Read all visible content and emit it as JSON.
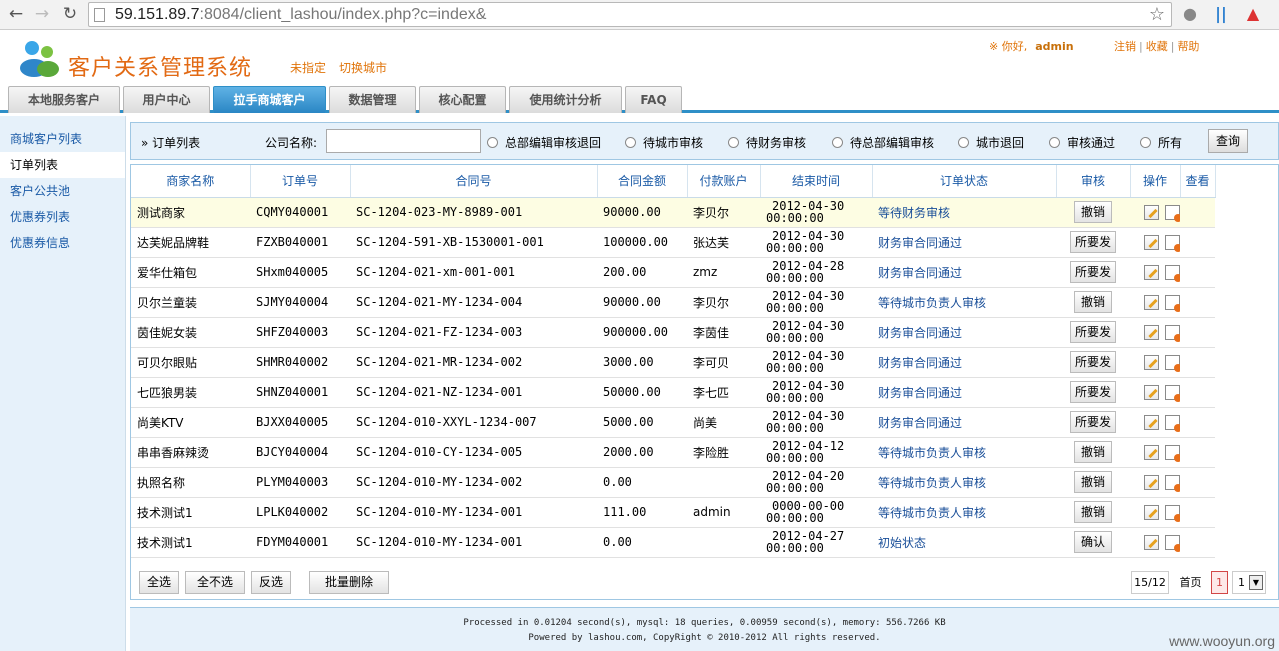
{
  "browser": {
    "url_host": "59.151.89.7",
    "url_rest": ":8084/client_lashou/index.php?c=index&"
  },
  "header": {
    "title": "客户关系管理系统",
    "unspecified": "未指定",
    "switch_city": "切换城市",
    "greeting": "※ 你好,",
    "username": "admin",
    "links": [
      "注销",
      "收藏",
      "帮助"
    ]
  },
  "tabs": [
    {
      "label": "本地服务客户"
    },
    {
      "label": "用户中心"
    },
    {
      "label": "拉手商城客户",
      "active": true
    },
    {
      "label": "数据管理"
    },
    {
      "label": "核心配置"
    },
    {
      "label": "使用统计分析"
    },
    {
      "label": "FAQ"
    }
  ],
  "sidebar": {
    "items": [
      {
        "label": "商城客户列表"
      },
      {
        "label": "订单列表",
        "active": true
      },
      {
        "label": "客户公共池"
      },
      {
        "label": "优惠券列表"
      },
      {
        "label": "优惠券信息"
      }
    ]
  },
  "filter": {
    "crumb": "» 订单列表",
    "company_label": "公司名称:",
    "company_value": "",
    "radios": [
      "总部编辑审核退回",
      "待城市审核",
      "待财务审核",
      "待总部编辑审核",
      "城市退回",
      "审核通过",
      "所有"
    ],
    "query_label": "查询"
  },
  "table": {
    "headers": [
      "商家名称",
      "订单号",
      "合同号",
      "合同金额",
      "付款账户",
      "结束时间",
      "订单状态",
      "审核",
      "操作",
      "查看"
    ],
    "rows": [
      {
        "merchant": "测试商家",
        "order": "CQMY040001",
        "contract": "SC-1204-023-MY-8989-001",
        "amount": "90000.00",
        "account": "李贝尔",
        "end_date": "2012-04-30",
        "end_time": "00:00:00",
        "status": "等待财务审核",
        "audit": "撤销"
      },
      {
        "merchant": "达芙妮品牌鞋",
        "order": "FZXB040001",
        "contract": "SC-1204-591-XB-1530001-001",
        "amount": "100000.00",
        "account": "张达芙",
        "end_date": "2012-04-30",
        "end_time": "00:00:00",
        "status": "财务审合同通过",
        "audit": "所要发"
      },
      {
        "merchant": "爱华仕箱包",
        "order": "SHxm040005",
        "contract": "SC-1204-021-xm-001-001",
        "amount": "200.00",
        "account": "zmz",
        "end_date": "2012-04-28",
        "end_time": "00:00:00",
        "status": "财务审合同通过",
        "audit": "所要发"
      },
      {
        "merchant": "贝尔兰童装",
        "order": "SJMY040004",
        "contract": "SC-1204-021-MY-1234-004",
        "amount": "90000.00",
        "account": "李贝尔",
        "end_date": "2012-04-30",
        "end_time": "00:00:00",
        "status": "等待城市负责人审核",
        "audit": "撤销"
      },
      {
        "merchant": "茵佳妮女装",
        "order": "SHFZ040003",
        "contract": "SC-1204-021-FZ-1234-003",
        "amount": "900000.00",
        "account": "李茵佳",
        "end_date": "2012-04-30",
        "end_time": "00:00:00",
        "status": "财务审合同通过",
        "audit": "所要发"
      },
      {
        "merchant": "可贝尔眼贴",
        "order": "SHMR040002",
        "contract": "SC-1204-021-MR-1234-002",
        "amount": "3000.00",
        "account": "李可贝",
        "end_date": "2012-04-30",
        "end_time": "00:00:00",
        "status": "财务审合同通过",
        "audit": "所要发"
      },
      {
        "merchant": "七匹狼男装",
        "order": "SHNZ040001",
        "contract": "SC-1204-021-NZ-1234-001",
        "amount": "50000.00",
        "account": "李七匹",
        "end_date": "2012-04-30",
        "end_time": "00:00:00",
        "status": "财务审合同通过",
        "audit": "所要发"
      },
      {
        "merchant": "尚美KTV",
        "order": "BJXX040005",
        "contract": "SC-1204-010-XXYL-1234-007",
        "amount": "5000.00",
        "account": "尚美",
        "end_date": "2012-04-30",
        "end_time": "00:00:00",
        "status": "财务审合同通过",
        "audit": "所要发"
      },
      {
        "merchant": "串串香麻辣烫",
        "order": "BJCY040004",
        "contract": "SC-1204-010-CY-1234-005",
        "amount": "2000.00",
        "account": "李险胜",
        "end_date": "2012-04-12",
        "end_time": "00:00:00",
        "status": "等待城市负责人审核",
        "audit": "撤销"
      },
      {
        "merchant": "执照名称",
        "order": "PLYM040003",
        "contract": "SC-1204-010-MY-1234-002",
        "amount": "0.00",
        "account": "",
        "end_date": "2012-04-20",
        "end_time": "00:00:00",
        "status": "等待城市负责人审核",
        "audit": "撤销"
      },
      {
        "merchant": "技术测试1",
        "order": "LPLK040002",
        "contract": "SC-1204-010-MY-1234-001",
        "amount": "111.00",
        "account": "admin",
        "end_date": "0000-00-00",
        "end_time": "00:00:00",
        "status": "等待城市负责人审核",
        "audit": "撤销"
      },
      {
        "merchant": "技术测试1",
        "order": "FDYM040001",
        "contract": "SC-1204-010-MY-1234-001",
        "amount": "0.00",
        "account": "",
        "end_date": "2012-04-27",
        "end_time": "00:00:00",
        "status": "初始状态",
        "audit": "确认"
      }
    ]
  },
  "bulk": {
    "select_all": "全选",
    "select_none": "全不选",
    "invert": "反选",
    "batch_delete": "批量删除"
  },
  "pager": {
    "count": "15/12",
    "first": "首页",
    "current": "1",
    "select_value": "1"
  },
  "footer": {
    "line1": "Processed in 0.01204 second(s), mysql: 18 queries, 0.00959 second(s), memory: 556.7266 KB",
    "line2": "Powered by lashou.com, CopyRight © 2010-2012 All rights reserved."
  },
  "watermark": "www.wooyun.org",
  "colors": {
    "accent_blue": "#2e8fc7",
    "title_orange": "#e26a14",
    "status_blue": "#1a4f99"
  }
}
